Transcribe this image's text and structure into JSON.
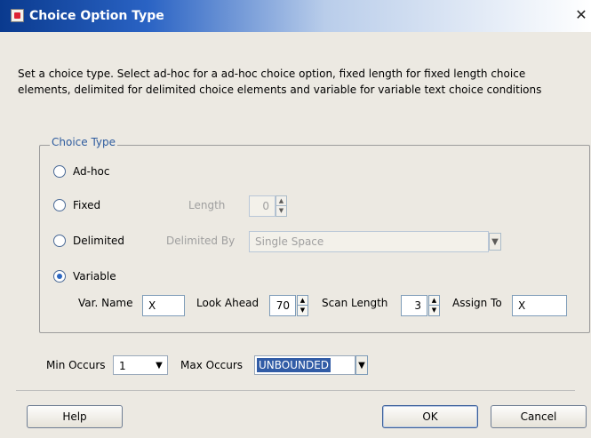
{
  "window": {
    "title": "Choice Option Type"
  },
  "description": "Set a choice type. Select ad-hoc for a ad-hoc choice option, fixed length for fixed length choice elements, delimited for delimited choice elements and variable for variable text choice conditions",
  "choice_type": {
    "legend": "Choice Type",
    "options": [
      {
        "label": "Ad-hoc",
        "selected": false
      },
      {
        "label": "Fixed",
        "selected": false
      },
      {
        "label": "Delimited",
        "selected": false
      },
      {
        "label": "Variable",
        "selected": true
      }
    ],
    "fixed": {
      "length_label": "Length",
      "length_value": "0"
    },
    "delimited": {
      "by_label": "Delimited By",
      "by_value": "Single Space"
    },
    "variable": {
      "var_name_label": "Var. Name",
      "var_name_value": "X",
      "look_ahead_label": "Look Ahead",
      "look_ahead_value": "70",
      "scan_length_label": "Scan Length",
      "scan_length_value": "3",
      "assign_to_label": "Assign To",
      "assign_to_value": "X"
    }
  },
  "occurs": {
    "min_label": "Min Occurs",
    "min_value": "1",
    "max_label": "Max Occurs",
    "max_value": "UNBOUNDED"
  },
  "buttons": {
    "help": "Help",
    "ok": "OK",
    "cancel": "Cancel"
  },
  "icons": {
    "close": "✕",
    "spinner_up": "▲",
    "spinner_down": "▼",
    "dropdown": "▼"
  }
}
